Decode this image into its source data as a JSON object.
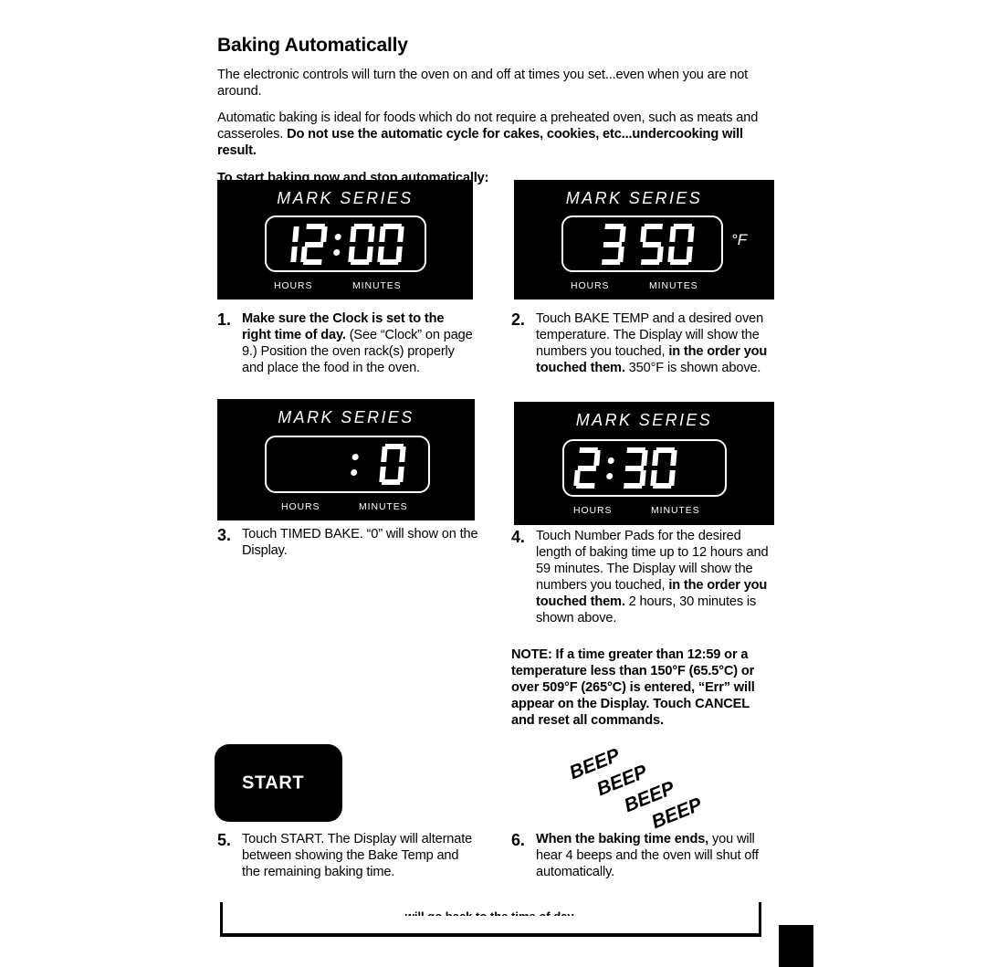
{
  "section": {
    "title": "Baking Automatically",
    "paragraphs": [
      {
        "id": "intro",
        "text": "The electronic controls will turn the oven on and off at times you set...even when you are not around."
      }
    ],
    "para2_normal": "Automatic baking is ideal for foods which do not require a preheated oven, such as meats and casseroles. ",
    "para2_bold": "Do not use the automatic cycle for cakes, cookies, etc...undercooking will result.",
    "lead": "To start baking now and stop automatically:"
  },
  "displays": [
    {
      "id": "display-clock",
      "brand": "MARK SERIES",
      "value": "12:00",
      "digits": [
        "1",
        "2",
        ":",
        "0",
        "0"
      ],
      "unit": "",
      "hours_label": "HOURS",
      "minutes_label": "MINUTES"
    },
    {
      "id": "display-bake-temp",
      "brand": "MARK SERIES",
      "value": "350",
      "digits": [
        "3",
        "5",
        "0"
      ],
      "unit": "°F",
      "hours_label": "HOURS",
      "minutes_label": "MINUTES"
    },
    {
      "id": "display-timed-bake",
      "brand": "MARK SERIES",
      "value": ":0",
      "digits": [
        " ",
        ":",
        "0"
      ],
      "unit": "",
      "hours_label": "HOURS",
      "minutes_label": "MINUTES"
    },
    {
      "id": "display-bake-time",
      "brand": "MARK SERIES",
      "value": "2:30",
      "digits": [
        "2",
        ":",
        "3",
        "0"
      ],
      "unit": "",
      "hours_label": "HOURS",
      "minutes_label": "MINUTES"
    }
  ],
  "steps": [
    {
      "number": "1.",
      "bold_lead": "Make sure the Clock is set to the right time of day.",
      "rest": " (See “Clock” on page 9.) Position the oven rack(s) properly and place the food in the oven."
    },
    {
      "number": "2.",
      "pre": "Touch BAKE TEMP and a desired oven temperature. The Display will show the numbers you touched, ",
      "bold_mid": "in the order you touched them.",
      "post": " 350°F is shown above."
    },
    {
      "number": "3.",
      "pre": "Touch TIMED BAKE. “0” will show on the Display.",
      "bold_mid": "",
      "post": ""
    },
    {
      "number": "4.",
      "pre": "Touch Number Pads for the desired length of baking time up to 12 hours and 59 minutes. The Display will show the numbers you touched, ",
      "bold_mid": "in the order you touched them.",
      "post": " 2 hours, 30 minutes is shown above."
    },
    {
      "number": "5.",
      "pre": "Touch START. The Display will alternate between showing the Bake Temp and the remaining baking time.",
      "bold_mid": "",
      "post": ""
    },
    {
      "number": "6.",
      "bold_lead": "When the baking time ends,",
      "rest": " you will hear 4 beeps and the oven will shut off automatically."
    }
  ],
  "note": "NOTE: If a time greater than 12:59 or a temperature less than 150°F (65.5°C) or over 509°F (265°C) is entered, “Err” will appear on the Display. Touch CANCEL and reset all commands.",
  "start_button": {
    "label": "START"
  },
  "beeps": [
    "BEEP",
    "BEEP",
    "BEEP",
    "BEEP"
  ],
  "cut_off_text": "will go back to the time of day.",
  "colors": {
    "panel_background": "#000000",
    "panel_foreground": "#ffffff",
    "page_background": "#ffffff",
    "text": "#000000"
  }
}
